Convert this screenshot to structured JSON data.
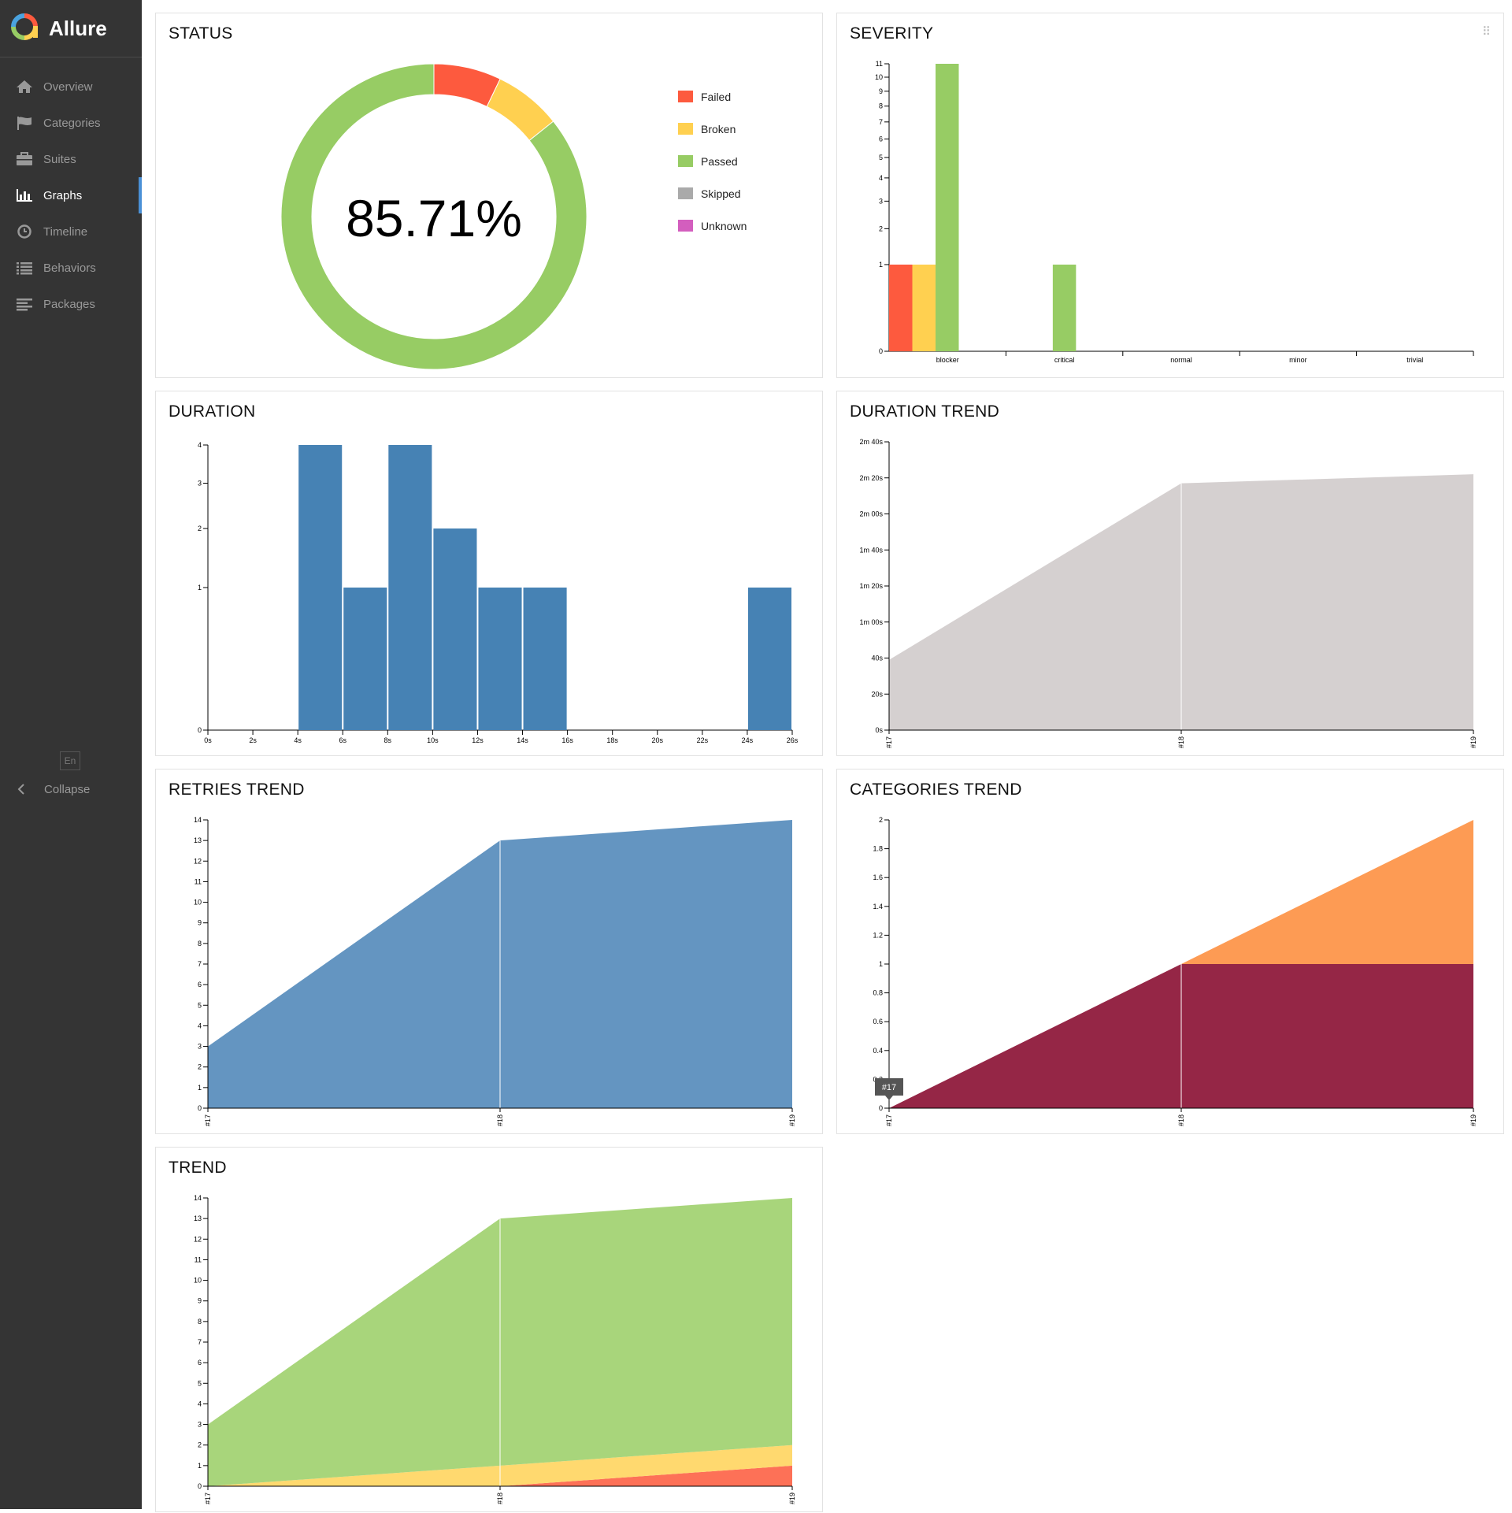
{
  "app": {
    "brand": "Allure",
    "lang": "En",
    "collapse_label": "Collapse"
  },
  "sidebar": {
    "items": [
      {
        "label": "Overview",
        "icon": "home-icon",
        "active": false
      },
      {
        "label": "Categories",
        "icon": "flag-icon",
        "active": false
      },
      {
        "label": "Suites",
        "icon": "briefcase-icon",
        "active": false
      },
      {
        "label": "Graphs",
        "icon": "bar-chart-icon",
        "active": true
      },
      {
        "label": "Timeline",
        "icon": "clock-icon",
        "active": false
      },
      {
        "label": "Behaviors",
        "icon": "list-icon",
        "active": false
      },
      {
        "label": "Packages",
        "icon": "align-left-icon",
        "active": false
      }
    ]
  },
  "widgets": {
    "status": {
      "title": "STATUS"
    },
    "severity": {
      "title": "SEVERITY"
    },
    "duration": {
      "title": "DURATION"
    },
    "duration_trend": {
      "title": "DURATION TREND"
    },
    "retries_trend": {
      "title": "RETRIES TREND"
    },
    "categories_trend": {
      "title": "CATEGORIES TREND"
    },
    "trend": {
      "title": "TREND"
    }
  },
  "colors": {
    "failed": "#fd5a3e",
    "broken": "#ffd050",
    "passed": "#97cc64",
    "skipped": "#aaaaaa",
    "unknown": "#d35ebe",
    "duration": "#4682b4",
    "duration_trend": "#d5d0d0",
    "retries": "#6495c1",
    "cat_product": "#fd9b54",
    "cat_test": "#952646",
    "trend_passed": "#a8d57b",
    "trend_broken": "#ffd96f",
    "trend_failed": "#fd7157"
  },
  "chart_data": [
    {
      "id": "status",
      "type": "pie",
      "center_label": "85.71%",
      "legend": [
        "Failed",
        "Broken",
        "Passed",
        "Skipped",
        "Unknown"
      ],
      "slices": [
        {
          "name": "Failed",
          "value": 1
        },
        {
          "name": "Broken",
          "value": 1
        },
        {
          "name": "Passed",
          "value": 12
        },
        {
          "name": "Skipped",
          "value": 0
        },
        {
          "name": "Unknown",
          "value": 0
        }
      ]
    },
    {
      "id": "severity",
      "type": "bar",
      "scale": "sqrt",
      "categories": [
        "blocker",
        "critical",
        "normal",
        "minor",
        "trivial"
      ],
      "yticks": [
        0,
        1,
        2,
        3,
        4,
        5,
        6,
        7,
        8,
        9,
        10,
        11
      ],
      "ylim": [
        0,
        11
      ],
      "series": [
        {
          "name": "Failed",
          "values": [
            1,
            0,
            0,
            0,
            0
          ]
        },
        {
          "name": "Broken",
          "values": [
            1,
            0,
            0,
            0,
            0
          ]
        },
        {
          "name": "Passed",
          "values": [
            11,
            1,
            0,
            0,
            0
          ]
        }
      ]
    },
    {
      "id": "duration",
      "type": "bar",
      "scale": "sqrt",
      "xticks": [
        "0s",
        "2s",
        "4s",
        "6s",
        "8s",
        "10s",
        "12s",
        "14s",
        "16s",
        "18s",
        "20s",
        "22s",
        "24s",
        "26s"
      ],
      "yticks": [
        0,
        1,
        2,
        3,
        4
      ],
      "ylim": [
        0,
        4
      ],
      "bins": [
        {
          "from": 4,
          "to": 6,
          "count": 4
        },
        {
          "from": 6,
          "to": 8,
          "count": 1
        },
        {
          "from": 8,
          "to": 10,
          "count": 4
        },
        {
          "from": 10,
          "to": 12,
          "count": 2
        },
        {
          "from": 12,
          "to": 14,
          "count": 1
        },
        {
          "from": 14,
          "to": 16,
          "count": 1
        },
        {
          "from": 24,
          "to": 26,
          "count": 1
        }
      ]
    },
    {
      "id": "duration_trend",
      "type": "area",
      "x": [
        "#17",
        "#18",
        "#19"
      ],
      "ytick_labels": [
        "0s",
        "20s",
        "40s",
        "1m 00s",
        "1m 20s",
        "1m 40s",
        "2m 00s",
        "2m 20s",
        "2m 40s"
      ],
      "ylim": [
        0,
        160
      ],
      "series": [
        {
          "values": [
            39,
            137,
            142
          ]
        }
      ]
    },
    {
      "id": "retries_trend",
      "type": "area",
      "x": [
        "#17",
        "#18",
        "#19"
      ],
      "yticks": [
        0,
        1,
        2,
        3,
        4,
        5,
        6,
        7,
        8,
        9,
        10,
        11,
        12,
        13,
        14
      ],
      "ylim": [
        0,
        14
      ],
      "series": [
        {
          "values": [
            3,
            13,
            14
          ]
        }
      ]
    },
    {
      "id": "categories_trend",
      "type": "area",
      "stacked": true,
      "x": [
        "#17",
        "#18",
        "#19"
      ],
      "yticks": [
        0,
        0.2,
        0.4,
        0.6,
        0.8,
        1,
        1.2,
        1.4,
        1.6,
        1.8,
        2
      ],
      "ylim": [
        0,
        2
      ],
      "tooltip": "#17",
      "series": [
        {
          "values": [
            0,
            1,
            1
          ]
        },
        {
          "values": [
            0,
            0,
            1
          ]
        }
      ]
    },
    {
      "id": "trend",
      "type": "area",
      "stacked": true,
      "x": [
        "#17",
        "#18",
        "#19"
      ],
      "yticks": [
        0,
        1,
        2,
        3,
        4,
        5,
        6,
        7,
        8,
        9,
        10,
        11,
        12,
        13,
        14
      ],
      "ylim": [
        0,
        14
      ],
      "series": [
        {
          "name": "Failed",
          "values": [
            0,
            0,
            1
          ]
        },
        {
          "name": "Broken",
          "values": [
            0,
            1,
            1
          ]
        },
        {
          "name": "Passed",
          "values": [
            3,
            12,
            12
          ]
        }
      ]
    }
  ]
}
